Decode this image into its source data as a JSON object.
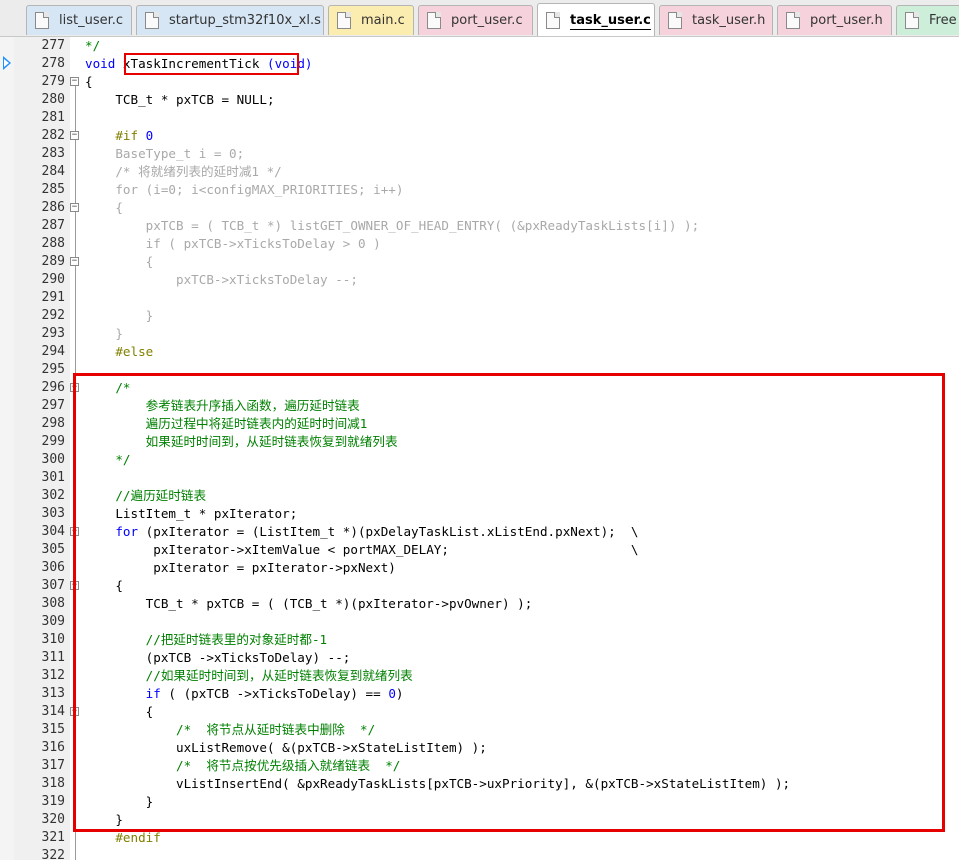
{
  "tabs": [
    {
      "label": "list_user.c",
      "color": "#d6e6f5",
      "active": false
    },
    {
      "label": "startup_stm32f10x_xl.s",
      "color": "#d6e6f5",
      "active": false
    },
    {
      "label": "main.c",
      "color": "#fbecb0",
      "active": false
    },
    {
      "label": "port_user.c",
      "color": "#f6d3dc",
      "active": false
    },
    {
      "label": "task_user.c",
      "color": "#ffffff",
      "active": true
    },
    {
      "label": "task_user.h",
      "color": "#f6d3dc",
      "active": false
    },
    {
      "label": "port_user.h",
      "color": "#f6d3dc",
      "active": false
    },
    {
      "label": "Free",
      "color": "#cdeed8",
      "active": false
    }
  ],
  "editor": {
    "current_line": 278,
    "lines": [
      {
        "n": "277",
        "fold": "",
        "code": [
          {
            "t": "*/",
            "c": "cm"
          }
        ]
      },
      {
        "n": "278",
        "fold": "",
        "code": [
          {
            "t": "void",
            "c": "kw"
          },
          {
            "t": " xTaskIncrementTick ",
            "c": ""
          },
          {
            "t": "(void)",
            "c": "kw"
          }
        ]
      },
      {
        "n": "279",
        "fold": "−",
        "code": [
          {
            "t": "{",
            "c": ""
          }
        ]
      },
      {
        "n": "280",
        "fold": "",
        "code": [
          {
            "t": "    TCB_t * pxTCB = NULL;",
            "c": ""
          }
        ]
      },
      {
        "n": "281",
        "fold": "",
        "code": []
      },
      {
        "n": "282",
        "fold": "−",
        "code": [
          {
            "t": "    #if ",
            "c": "pp"
          },
          {
            "t": "0",
            "c": "num"
          }
        ]
      },
      {
        "n": "283",
        "fold": "",
        "code": [
          {
            "t": "    BaseType_t i = 0;",
            "c": "gray"
          }
        ]
      },
      {
        "n": "284",
        "fold": "",
        "code": [
          {
            "t": "    /* 将就绪列表的延时减1 */",
            "c": "gray"
          }
        ]
      },
      {
        "n": "285",
        "fold": "",
        "code": [
          {
            "t": "    for (i=0; i<configMAX_PRIORITIES; i++)",
            "c": "gray"
          }
        ]
      },
      {
        "n": "286",
        "fold": "−",
        "code": [
          {
            "t": "    {",
            "c": "gray"
          }
        ]
      },
      {
        "n": "287",
        "fold": "",
        "code": [
          {
            "t": "        pxTCB = ( TCB_t *) listGET_OWNER_OF_HEAD_ENTRY( (&pxReadyTaskLists[i]) );",
            "c": "gray"
          }
        ]
      },
      {
        "n": "288",
        "fold": "",
        "code": [
          {
            "t": "        if ( pxTCB->xTicksToDelay > 0 )",
            "c": "gray"
          }
        ]
      },
      {
        "n": "289",
        "fold": "−",
        "code": [
          {
            "t": "        {",
            "c": "gray"
          }
        ]
      },
      {
        "n": "290",
        "fold": "",
        "code": [
          {
            "t": "            pxTCB->xTicksToDelay --;",
            "c": "gray"
          }
        ]
      },
      {
        "n": "291",
        "fold": "",
        "code": []
      },
      {
        "n": "292",
        "fold": "",
        "code": [
          {
            "t": "        }",
            "c": "gray"
          }
        ]
      },
      {
        "n": "293",
        "fold": "",
        "code": [
          {
            "t": "    }",
            "c": "gray"
          }
        ]
      },
      {
        "n": "294",
        "fold": "",
        "code": [
          {
            "t": "    #else",
            "c": "pp"
          }
        ]
      },
      {
        "n": "295",
        "fold": "",
        "code": []
      },
      {
        "n": "296",
        "fold": "−",
        "code": [
          {
            "t": "    /*",
            "c": "cm"
          }
        ]
      },
      {
        "n": "297",
        "fold": "",
        "code": [
          {
            "t": "        参考链表升序插入函数，遍历延时链表",
            "c": "cm"
          }
        ]
      },
      {
        "n": "298",
        "fold": "",
        "code": [
          {
            "t": "        遍历过程中将延时链表内的延时时间减1",
            "c": "cm"
          }
        ]
      },
      {
        "n": "299",
        "fold": "",
        "code": [
          {
            "t": "        如果延时时间到，从延时链表恢复到就绪列表",
            "c": "cm"
          }
        ]
      },
      {
        "n": "300",
        "fold": "",
        "code": [
          {
            "t": "    */",
            "c": "cm"
          }
        ]
      },
      {
        "n": "301",
        "fold": "",
        "code": []
      },
      {
        "n": "302",
        "fold": "",
        "code": [
          {
            "t": "    //遍历延时链表",
            "c": "cm"
          }
        ]
      },
      {
        "n": "303",
        "fold": "",
        "code": [
          {
            "t": "    ListItem_t * pxIterator;",
            "c": ""
          }
        ]
      },
      {
        "n": "304",
        "fold": "−",
        "code": [
          {
            "t": "    ",
            "c": ""
          },
          {
            "t": "for",
            "c": "kw"
          },
          {
            "t": " (pxIterator = (ListItem_t *)(pxDelayTaskList.xListEnd.pxNext);  \\",
            "c": ""
          }
        ]
      },
      {
        "n": "305",
        "fold": "",
        "code": [
          {
            "t": "         pxIterator->xItemValue < portMAX_DELAY;                        \\",
            "c": ""
          }
        ]
      },
      {
        "n": "306",
        "fold": "",
        "code": [
          {
            "t": "         pxIterator = pxIterator->pxNext)",
            "c": ""
          }
        ]
      },
      {
        "n": "307",
        "fold": "−",
        "code": [
          {
            "t": "    {",
            "c": ""
          }
        ]
      },
      {
        "n": "308",
        "fold": "",
        "code": [
          {
            "t": "        TCB_t * pxTCB = ( (TCB_t *)(pxIterator->pvOwner) );",
            "c": ""
          }
        ]
      },
      {
        "n": "309",
        "fold": "",
        "code": []
      },
      {
        "n": "310",
        "fold": "",
        "code": [
          {
            "t": "        //把延时链表里的对象延时都-1",
            "c": "cm"
          }
        ]
      },
      {
        "n": "311",
        "fold": "",
        "code": [
          {
            "t": "        (pxTCB ->xTicksToDelay) --;",
            "c": ""
          }
        ]
      },
      {
        "n": "312",
        "fold": "",
        "code": [
          {
            "t": "        //如果延时时间到，从延时链表恢复到就绪列表",
            "c": "cm"
          }
        ]
      },
      {
        "n": "313",
        "fold": "",
        "code": [
          {
            "t": "        ",
            "c": ""
          },
          {
            "t": "if",
            "c": "kw"
          },
          {
            "t": " ( (pxTCB ->xTicksToDelay) == ",
            "c": ""
          },
          {
            "t": "0",
            "c": "num"
          },
          {
            "t": ")",
            "c": ""
          }
        ]
      },
      {
        "n": "314",
        "fold": "−",
        "code": [
          {
            "t": "        {",
            "c": ""
          }
        ]
      },
      {
        "n": "315",
        "fold": "",
        "code": [
          {
            "t": "            /*  将节点从延时链表中删除  */",
            "c": "cm"
          }
        ]
      },
      {
        "n": "316",
        "fold": "",
        "code": [
          {
            "t": "            uxListRemove( &(pxTCB->xStateListItem) );",
            "c": ""
          }
        ]
      },
      {
        "n": "317",
        "fold": "",
        "code": [
          {
            "t": "            /*  将节点按优先级插入就绪链表  */",
            "c": "cm"
          }
        ]
      },
      {
        "n": "318",
        "fold": "",
        "code": [
          {
            "t": "            vListInsertEnd( &pxReadyTaskLists[pxTCB->uxPriority], &(pxTCB->xStateListItem) );",
            "c": ""
          }
        ]
      },
      {
        "n": "319",
        "fold": "",
        "code": [
          {
            "t": "        }",
            "c": ""
          }
        ]
      },
      {
        "n": "320",
        "fold": "",
        "code": [
          {
            "t": "    }",
            "c": ""
          }
        ]
      },
      {
        "n": "321",
        "fold": "",
        "code": [
          {
            "t": "    #endif",
            "c": "pp"
          }
        ]
      },
      {
        "n": "322",
        "fold": "",
        "code": []
      }
    ]
  },
  "icons": {
    "file_icon": "file-icon",
    "fold_marker": "fold-minus-icon",
    "current_line_marker": "current-line-arrow-icon"
  },
  "colors": {
    "keyword": "#0000ff",
    "comment": "#008000",
    "preprocessor": "#808000",
    "inactive_code": "#a9a9a9",
    "highlight_box": "#e60000"
  }
}
